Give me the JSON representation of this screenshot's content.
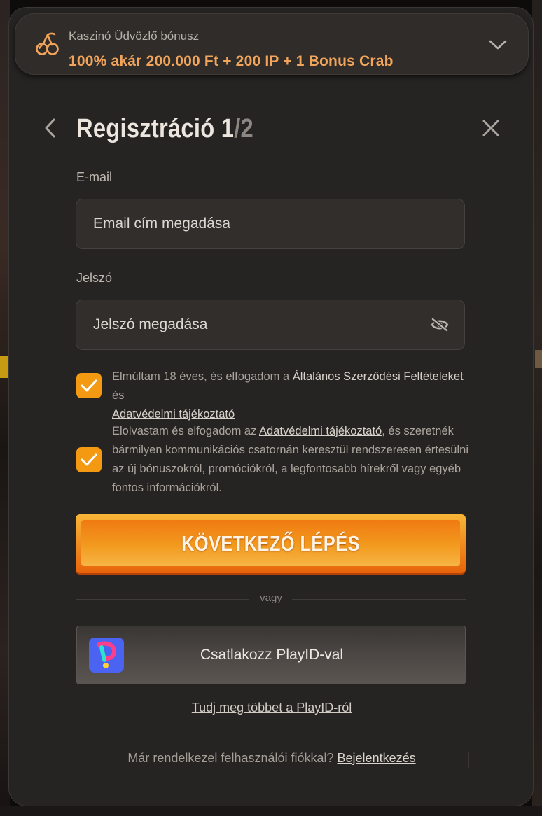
{
  "bonus": {
    "title": "Kaszinó Üdvözlő bónusz",
    "value": "100% akár 200.000 Ft + 200 IP + 1 Bonus Crab",
    "icon": "cherries-icon",
    "accent": "#f2a55a"
  },
  "header": {
    "title": "Regisztráció 1",
    "step_separator": "/",
    "step_total": "2"
  },
  "form": {
    "email_label": "E-mail",
    "email_placeholder": "Email cím megadása",
    "email_value": "",
    "password_label": "Jelszó",
    "password_placeholder": "Jelszó megadása",
    "password_value": ""
  },
  "consents": [
    {
      "checked": true,
      "text_before": "Elmúltam 18 éves, és elfogadom a ",
      "link1": "Általános Szerződési Feltételeket",
      "text_middle": " és ",
      "link2": "Adatvédelmi tájékoztató"
    },
    {
      "checked": true,
      "text_before": "Elolvastam és elfogadom az ",
      "link1": "Adatvédelmi tájékoztató",
      "text_after": ", és szeretnék bármilyen kommunikációs csatornán keresztül rendszeresen értesülni az új bónuszokról, promóciókról, a legfontosabb hírekről vagy egyéb fontos információkról."
    }
  ],
  "cta": {
    "label": "KÖVETKEZŐ LÉPÉS",
    "color": "#f39a12"
  },
  "divider": {
    "label": "vagy"
  },
  "playid": {
    "label": "Csatlakozz PlayID-val",
    "learn_more": "Tudj meg többet a PlayID-ról"
  },
  "footer": {
    "text": "Már rendelkezel felhasználói fiókkal? ",
    "login_link": "Bejelentkezés"
  }
}
